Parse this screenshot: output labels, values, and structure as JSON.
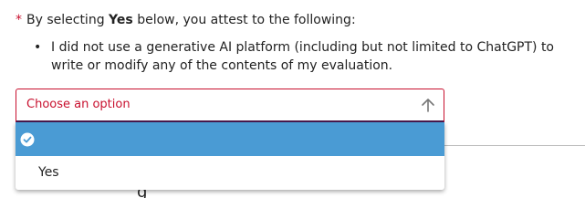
{
  "question": {
    "required_marker": "*",
    "text_before": "By selecting",
    "emphasis": "Yes",
    "text_after": "below, you attest to the following:"
  },
  "bullets": [
    {
      "marker": "•",
      "text": "I did not use a generative AI platform (including but not limited to ChatGPT) to write or modify any of the contents of my evaluation."
    }
  ],
  "select": {
    "placeholder": "Choose an option",
    "icon": "arrow-up-icon"
  },
  "dropdown": {
    "options": [
      {
        "label": "",
        "selected": true,
        "icon": "check-circle-icon"
      },
      {
        "label": "Yes",
        "selected": false
      }
    ]
  },
  "colors": {
    "required": "#c8102e",
    "select_border": "#c8102e",
    "select_underline": "#4a1a4f",
    "selected_option_bg": "#4a9bd4"
  }
}
